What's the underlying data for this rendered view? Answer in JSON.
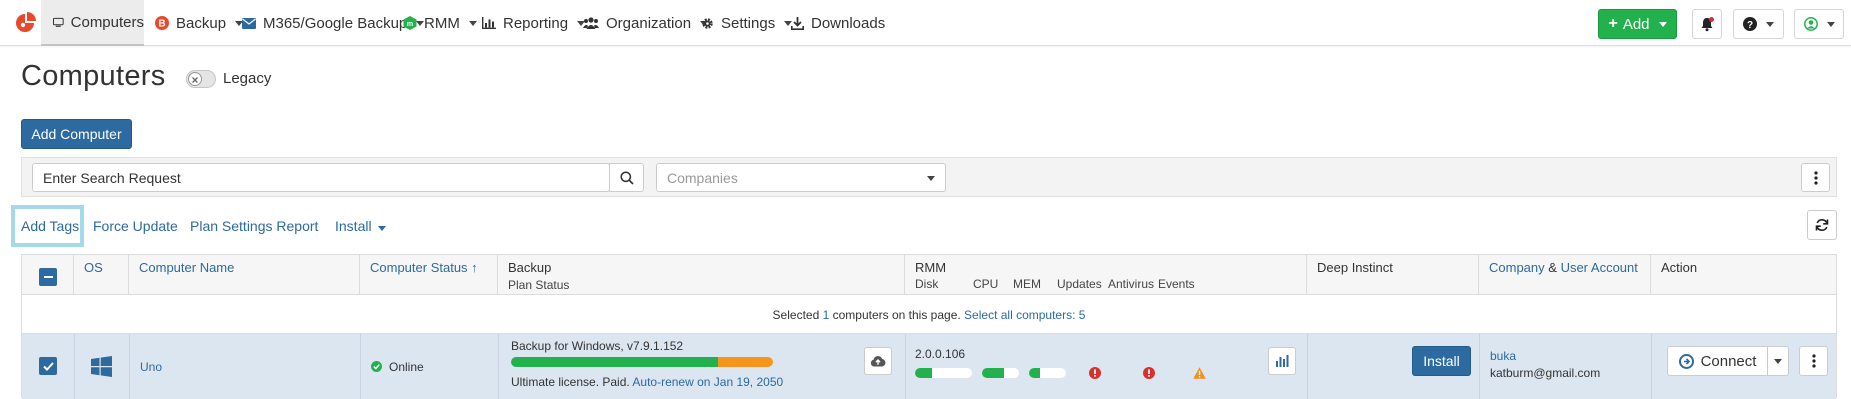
{
  "nav": {
    "items": [
      {
        "label": "Computers",
        "icon": "monitor-icon"
      },
      {
        "label": "Backup",
        "icon": "backup-icon"
      },
      {
        "label": "M365/Google Backup",
        "icon": "mail-icon"
      },
      {
        "label": "RMM",
        "icon": "rmm-icon"
      },
      {
        "label": "Reporting",
        "icon": "bar-chart-icon"
      },
      {
        "label": "Organization",
        "icon": "users-icon"
      },
      {
        "label": "Settings",
        "icon": "gear-icon"
      },
      {
        "label": "Downloads",
        "icon": "download-icon"
      }
    ],
    "add_label": "Add",
    "brand_color": "#e8492b",
    "add_color": "#22b14c"
  },
  "page": {
    "title": "Computers",
    "legacy_label": "Legacy",
    "add_computer_label": "Add Computer"
  },
  "filters": {
    "search_placeholder": "Enter Search Request",
    "companies_placeholder": "Companies"
  },
  "actions": {
    "add_tags": "Add Tags",
    "force_update": "Force Update",
    "plan_settings_report": "Plan Settings Report",
    "install": "Install"
  },
  "table": {
    "headers": {
      "os": "OS",
      "computer_name": "Computer Name",
      "computer_status": "Computer Status",
      "sort_arrow": "↑",
      "backup": "Backup",
      "plan_status": "Plan Status",
      "rmm": "RMM",
      "rmm_sub": [
        "Disk",
        "CPU",
        "MEM",
        "Updates",
        "Antivirus",
        "Events"
      ],
      "deep_instinct": "Deep Instinct",
      "company": "Company",
      "amp": "&",
      "user_account": "User Account",
      "action": "Action"
    },
    "selection": {
      "prefix": "Selected",
      "count": "1",
      "suffix": "computers on this page.",
      "select_all": "Select all computers: 5"
    },
    "rows": [
      {
        "os": "windows-icon",
        "name": "Uno",
        "status": "Online",
        "backup_version": "Backup for Windows, v7.9.1.152",
        "backup_bar_green": 0.79,
        "backup_bar_orange": 0.21,
        "license": "Ultimate license. Paid.",
        "autorenew": "Auto-renew on Jan 19, 2050",
        "rmm_version": "2.0.0.106",
        "disk_usage": 0.3,
        "cpu_usage": 0.6,
        "mem_usage": 0.3,
        "deep_instinct_button": "Install",
        "company": "buka",
        "user": "katburm@gmail.com",
        "connect_label": "Connect"
      }
    ]
  },
  "colors": {
    "link": "#2c6aa0",
    "row_selected": "#dce6f1",
    "status_ok": "#22b14c",
    "error": "#d9302c",
    "warning": "#f0901e",
    "bar_orange": "#f7941d"
  }
}
